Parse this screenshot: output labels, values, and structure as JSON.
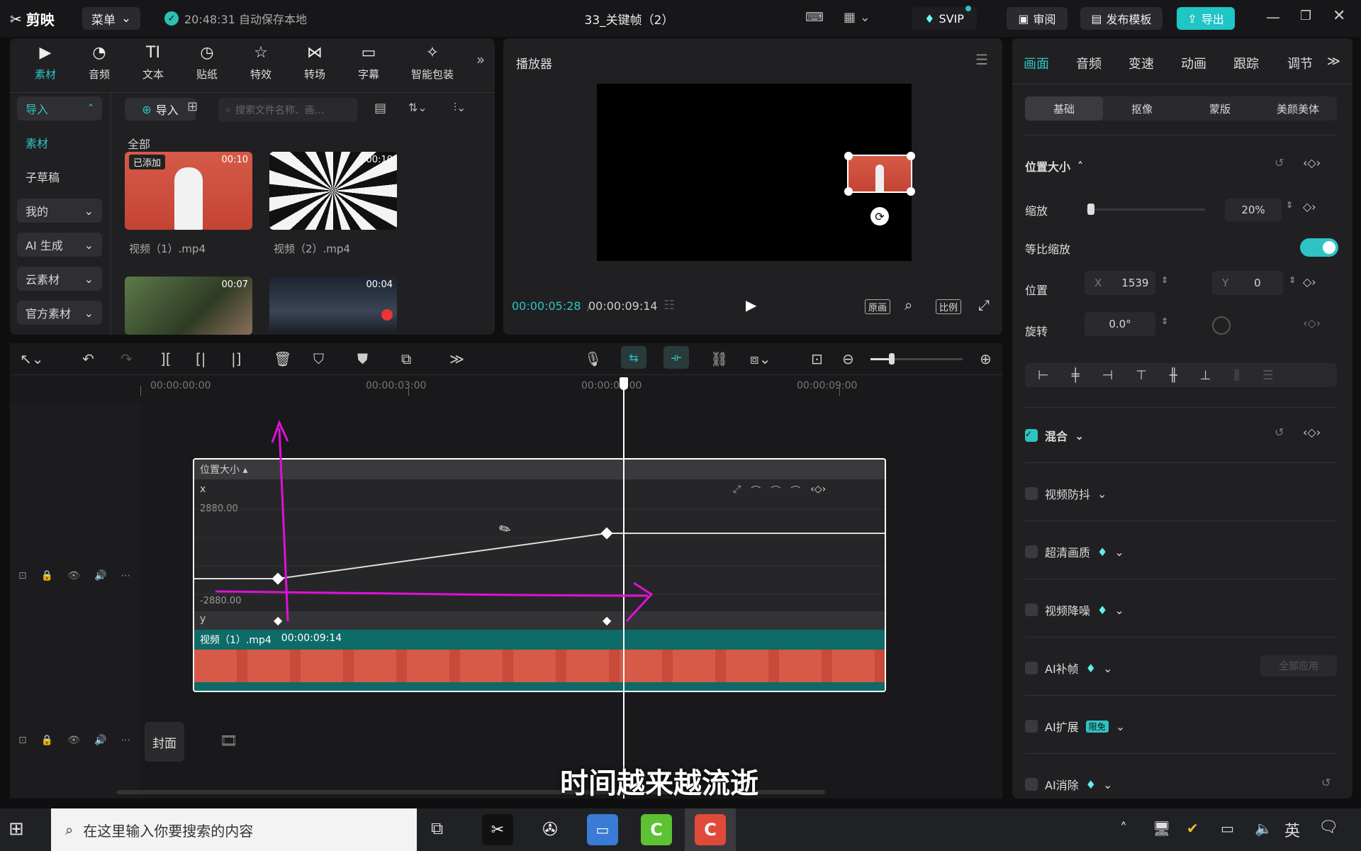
{
  "app": {
    "name": "剪映",
    "menu": "菜单",
    "autosave": "20:48:31 自动保存本地",
    "project": "33_关键帧（2）",
    "svip": "SVIP",
    "review": "审阅",
    "publish": "发布模板",
    "export": "导出"
  },
  "media": {
    "tools": [
      "素材",
      "音频",
      "文本",
      "贴纸",
      "特效",
      "转场",
      "字幕",
      "智能包装"
    ],
    "nav": [
      "导入",
      "素材",
      "子草稿",
      "我的",
      "AI 生成",
      "云素材",
      "官方素材"
    ],
    "import_btn": "导入",
    "search_placeholder": "搜索文件名称、画...",
    "category": "全部",
    "items": [
      {
        "name": "视频（1）.mp4",
        "duration": "00:10",
        "badge": "已添加"
      },
      {
        "name": "视频（2）.mp4",
        "duration": "00:10"
      },
      {
        "name": "",
        "duration": "00:07"
      },
      {
        "name": "",
        "duration": "00:04"
      }
    ]
  },
  "player": {
    "title": "播放器",
    "current": "00:00:05:28",
    "total": "00:00:09:14",
    "btn_original": "原画",
    "btn_ratio": "比例"
  },
  "props": {
    "tabs": [
      "画面",
      "音频",
      "变速",
      "动画",
      "跟踪",
      "调节"
    ],
    "subtabs": [
      "基础",
      "抠像",
      "蒙版",
      "美颜美体"
    ],
    "pos_size": "位置大小",
    "scale_label": "缩放",
    "scale_value": "20%",
    "scale_fraction": 0.2,
    "ratio_scale": "等比缩放",
    "position_label": "位置",
    "x_label": "X",
    "x_value": "1539",
    "y_label": "Y",
    "y_value": "0",
    "rotate_label": "旋转",
    "rotate_value": "0.0°",
    "blend": "混合",
    "stabilize": "视频防抖",
    "hd": "超清画质",
    "denoise": "视频降噪",
    "ai_frame": "AI补帧",
    "apply_all": "全部应用",
    "ai_expand": "AI扩展",
    "limited_free": "限免",
    "ai_erase": "AI消除"
  },
  "timeline": {
    "ticks": [
      "00:00:00:00",
      "00:00:03:00",
      "00:00:06:00",
      "00:00:09:00"
    ],
    "graph_title": "位置大小",
    "x_axis": "x",
    "y_axis": "y",
    "max": "2880.00",
    "min": "-2880.00",
    "clip_name": "视频（1）.mp4",
    "clip_duration": "00:00:09:14",
    "cover": "封面"
  },
  "subtitle": "时间越来越流逝",
  "taskbar": {
    "search_placeholder": "在这里输入你要搜索的内容",
    "ime": "英"
  },
  "colors": {
    "accent": "#2fc3c3",
    "export": "#20c5c5",
    "clip": "#0d6b68",
    "annotation": "#e010d8",
    "thumb_red": "#d94a3c"
  }
}
